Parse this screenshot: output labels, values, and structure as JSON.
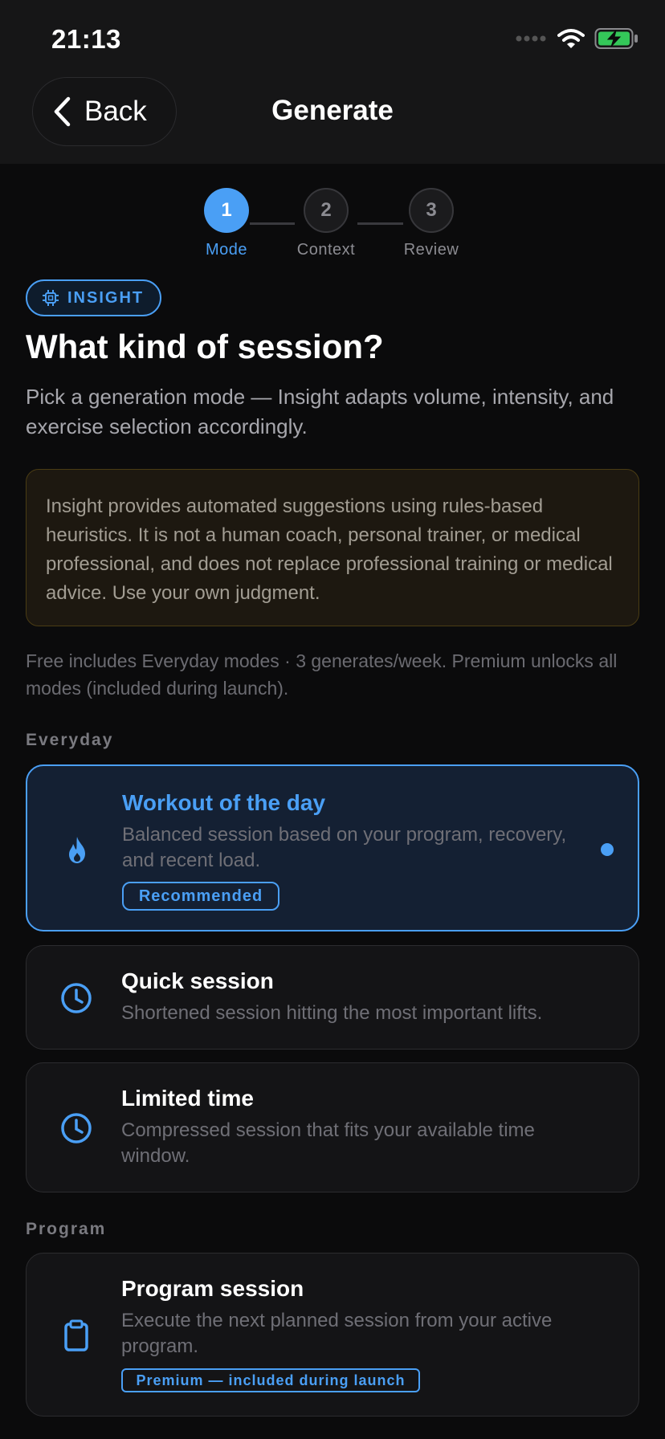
{
  "status_bar": {
    "time": "21:13"
  },
  "nav": {
    "back_label": "Back",
    "title": "Generate"
  },
  "stepper": {
    "steps": [
      {
        "number": "1",
        "label": "Mode"
      },
      {
        "number": "2",
        "label": "Context"
      },
      {
        "number": "3",
        "label": "Review"
      }
    ]
  },
  "badge": {
    "label": "INSIGHT"
  },
  "header": {
    "title": "What kind of session?",
    "subtitle": "Pick a generation mode — Insight adapts volume, intensity, and exercise selection accordingly."
  },
  "disclaimer": "Insight provides automated suggestions using rules-based heuristics. It is not a human coach, personal trainer, or medical professional, and does not replace professional training or medical advice. Use your own judgment.",
  "free_note": "Free includes Everyday modes · 3 generates/week. Premium unlocks all modes (included during launch).",
  "sections": {
    "everyday": {
      "label": "Everyday",
      "cards": [
        {
          "title": "Workout of the day",
          "description": "Balanced session based on your program, recovery, and recent load.",
          "tag": "Recommended",
          "icon": "flame-icon"
        },
        {
          "title": "Quick session",
          "description": "Shortened session hitting the most important lifts.",
          "icon": "clock-icon"
        },
        {
          "title": "Limited time",
          "description": "Compressed session that fits your available time window.",
          "icon": "clock-icon"
        }
      ]
    },
    "program": {
      "label": "Program",
      "cards": [
        {
          "title": "Program session",
          "description": "Execute the next planned session from your active program.",
          "tag": "Premium — included during launch",
          "icon": "clipboard-icon"
        }
      ]
    }
  },
  "colors": {
    "accent": "#4a9ff5",
    "background": "#0b0b0c",
    "battery": "#34c759"
  }
}
